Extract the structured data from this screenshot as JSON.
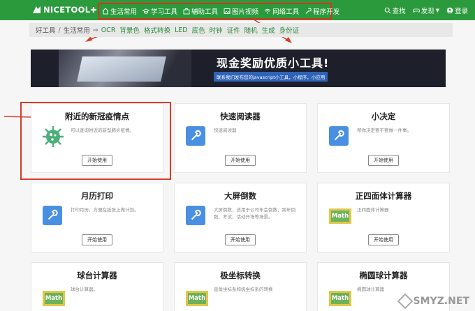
{
  "header": {
    "logo_text": "NICETOOL",
    "nav": [
      {
        "label": "生活常用",
        "icon": "home-icon"
      },
      {
        "label": "学习工具",
        "icon": "graduation-cap-icon"
      },
      {
        "label": "辅助工具",
        "icon": "briefcase-icon"
      },
      {
        "label": "图片视频",
        "icon": "image-icon"
      },
      {
        "label": "网络工具",
        "icon": "wifi-icon"
      },
      {
        "label": "程序开发",
        "icon": "wrench-icon"
      }
    ],
    "search_label": "查找",
    "discover_label": "发现",
    "login_label": "登录"
  },
  "breadcrumb": {
    "root": "好工具",
    "current": "生活常用",
    "arrow": "⇒",
    "links": [
      "OCR",
      "背景色",
      "格式转换",
      "LED",
      "底色",
      "时钟",
      "证件",
      "随机",
      "生成",
      "身份证"
    ]
  },
  "banner": {
    "title": "现金奖励优质小工具!",
    "subtitle": "联系我们发布您的javascript小工具，小程序，小应用"
  },
  "cards": [
    {
      "title": "附近的新冠疫情点",
      "desc": "可以查询附近的新型肺炎疫情。",
      "button": "开始使用",
      "icon": "virus-icon"
    },
    {
      "title": "快速阅读器",
      "desc": "快速阅读器",
      "button": "开始使用",
      "icon": "wrench-icon"
    },
    {
      "title": "小决定",
      "desc": "帮你决定要不要做一件事。",
      "button": "开始使用",
      "icon": "wrench-icon"
    },
    {
      "title": "月历打印",
      "desc": "打印月历，方便在纸张上做计划。",
      "button": "开始使用",
      "icon": "wrench-icon"
    },
    {
      "title": "大屏倒数",
      "desc": "大屏倒数，适用于公司年会倒数、跨年倒数、考试、活动开场等场景。",
      "button": "开始使用",
      "icon": "wrench-icon"
    },
    {
      "title": "正四面体计算器",
      "desc": "正四面体计算器",
      "button": "开始使用",
      "icon": "math-icon",
      "icon_text": "Math"
    },
    {
      "title": "球台计算器",
      "desc": "球台计算器。",
      "button": "",
      "icon": "math-icon",
      "icon_text": "Math"
    },
    {
      "title": "极坐标转换",
      "desc": "直角坐标系和极坐标系的转换",
      "button": "",
      "icon": "math-icon",
      "icon_text": "Math"
    },
    {
      "title": "椭圆球计算器",
      "desc": "椭圆球计算器",
      "button": "",
      "icon": "math-icon",
      "icon_text": "Math"
    }
  ],
  "watermark": "SMYZ.NET",
  "colors": {
    "header_bg": "#2b9a3c",
    "highlight": "#d93b2b",
    "wrench_blue": "#4a90e2",
    "math_green": "#6cb25a"
  }
}
